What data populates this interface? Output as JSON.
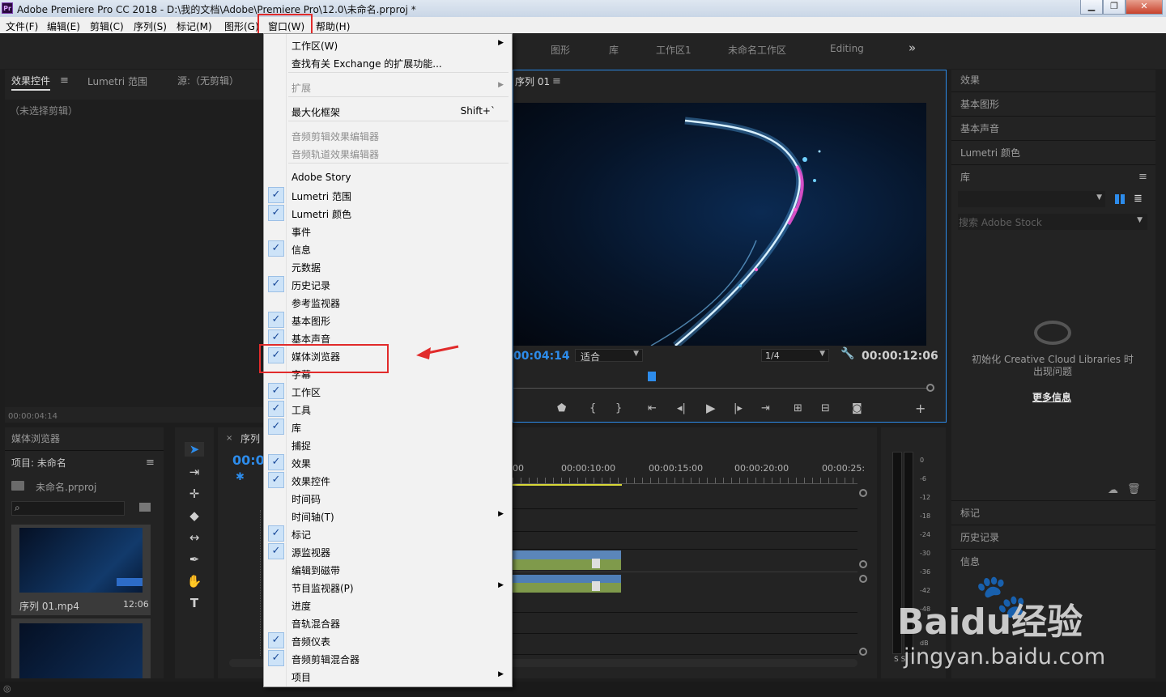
{
  "window": {
    "title": "Adobe Premiere Pro CC 2018 - D:\\我的文档\\Adobe\\Premiere Pro\\12.0\\未命名.prproj *",
    "icon_label": "Pr",
    "minimize": "▁",
    "restore": "❐",
    "close": "✕"
  },
  "menubar": [
    "文件(F)",
    "编辑(E)",
    "剪辑(C)",
    "序列(S)",
    "标记(M)",
    "图形(G)",
    "窗口(W)",
    "帮助(H)"
  ],
  "workspaces": [
    "图形",
    "库",
    "工作区1",
    "未命名工作区",
    "Editing"
  ],
  "workspace_more": "»",
  "left_panel": {
    "tabs": [
      "效果控件",
      "Lumetri 范围",
      "源:（无剪辑）"
    ],
    "no_clip": "（未选择剪辑）",
    "timecode": "00:00:04:14"
  },
  "project_panel": {
    "tab": "媒体浏览器",
    "project_label": "项目: 未命名",
    "file_name": "未命名.prproj",
    "clip_name": "序列 01.mp4",
    "clip_duration": "12:06"
  },
  "program_monitor": {
    "tab": "序列 01",
    "timecode": "00:04:14",
    "fit_option": "适合",
    "quality_option": "1/4",
    "duration": "00:00:12:06"
  },
  "timeline": {
    "tab": "序列",
    "timecode": "00:0",
    "ruler": [
      "00",
      "00:00:10:00",
      "00:00:15:00",
      "00:00:20:00",
      "00:00:25:"
    ]
  },
  "vu_meter": {
    "labels": [
      "0",
      "-6",
      "-12",
      "-18",
      "-24",
      "-30",
      "-36",
      "-42",
      "-48",
      "dB"
    ],
    "solo": "S S"
  },
  "right_panel": {
    "items": [
      "效果",
      "基本图形",
      "基本声音",
      "Lumetri 颜色"
    ],
    "library_tab": "库",
    "search_placeholder": "搜索 Adobe Stock",
    "cc_message": "初始化 Creative Cloud Libraries 时出现问题",
    "more_info": "更多信息",
    "bottom_items": [
      "标记",
      "历史记录",
      "信息"
    ]
  },
  "window_menu": {
    "items": [
      {
        "label": "工作区(W)",
        "checked": false,
        "submenu": true,
        "disabled": false
      },
      {
        "label": "查找有关 Exchange 的扩展功能...",
        "checked": false,
        "submenu": false,
        "disabled": false
      },
      {
        "label": "扩展",
        "checked": false,
        "submenu": true,
        "disabled": true
      },
      {
        "label": "最大化框架",
        "checked": false,
        "submenu": false,
        "disabled": false,
        "shortcut": "Shift+`"
      },
      {
        "label": "音频剪辑效果编辑器",
        "checked": false,
        "submenu": false,
        "disabled": true
      },
      {
        "label": "音频轨道效果编辑器",
        "checked": false,
        "submenu": false,
        "disabled": true
      },
      {
        "label": "Adobe Story",
        "checked": false,
        "submenu": false,
        "disabled": false
      },
      {
        "label": "Lumetri 范围",
        "checked": true,
        "submenu": false,
        "disabled": false
      },
      {
        "label": "Lumetri 颜色",
        "checked": true,
        "submenu": false,
        "disabled": false
      },
      {
        "label": "事件",
        "checked": false,
        "submenu": false,
        "disabled": false
      },
      {
        "label": "信息",
        "checked": true,
        "submenu": false,
        "disabled": false
      },
      {
        "label": "元数据",
        "checked": false,
        "submenu": false,
        "disabled": false
      },
      {
        "label": "历史记录",
        "checked": true,
        "submenu": false,
        "disabled": false
      },
      {
        "label": "参考监视器",
        "checked": false,
        "submenu": false,
        "disabled": false
      },
      {
        "label": "基本图形",
        "checked": true,
        "submenu": false,
        "disabled": false
      },
      {
        "label": "基本声音",
        "checked": true,
        "submenu": false,
        "disabled": false
      },
      {
        "label": "媒体浏览器",
        "checked": true,
        "submenu": false,
        "disabled": false
      },
      {
        "label": "字幕",
        "checked": false,
        "submenu": false,
        "disabled": false
      },
      {
        "label": "工作区",
        "checked": true,
        "submenu": false,
        "disabled": false
      },
      {
        "label": "工具",
        "checked": true,
        "submenu": false,
        "disabled": false
      },
      {
        "label": "库",
        "checked": true,
        "submenu": false,
        "disabled": false
      },
      {
        "label": "捕捉",
        "checked": false,
        "submenu": false,
        "disabled": false
      },
      {
        "label": "效果",
        "checked": true,
        "submenu": false,
        "disabled": false
      },
      {
        "label": "效果控件",
        "checked": true,
        "submenu": false,
        "disabled": false
      },
      {
        "label": "时间码",
        "checked": false,
        "submenu": false,
        "disabled": false
      },
      {
        "label": "时间轴(T)",
        "checked": false,
        "submenu": true,
        "disabled": false
      },
      {
        "label": "标记",
        "checked": true,
        "submenu": false,
        "disabled": false
      },
      {
        "label": "源监视器",
        "checked": true,
        "submenu": false,
        "disabled": false
      },
      {
        "label": "编辑到磁带",
        "checked": false,
        "submenu": false,
        "disabled": false
      },
      {
        "label": "节目监视器(P)",
        "checked": false,
        "submenu": true,
        "disabled": false
      },
      {
        "label": "进度",
        "checked": false,
        "submenu": false,
        "disabled": false
      },
      {
        "label": "音轨混合器",
        "checked": false,
        "submenu": false,
        "disabled": false
      },
      {
        "label": "音频仪表",
        "checked": true,
        "submenu": false,
        "disabled": false
      },
      {
        "label": "音频剪辑混合器",
        "checked": true,
        "submenu": false,
        "disabled": false
      },
      {
        "label": "项目",
        "checked": false,
        "submenu": true,
        "disabled": false
      }
    ]
  },
  "watermark": {
    "brand": "Baidu经验",
    "url": "jingyan.baidu.com"
  },
  "colors": {
    "accent_blue": "#2d8ceb",
    "highlight_red": "#e12b2b",
    "menu_bg": "#f2f2f2",
    "panel_bg": "#232323"
  }
}
